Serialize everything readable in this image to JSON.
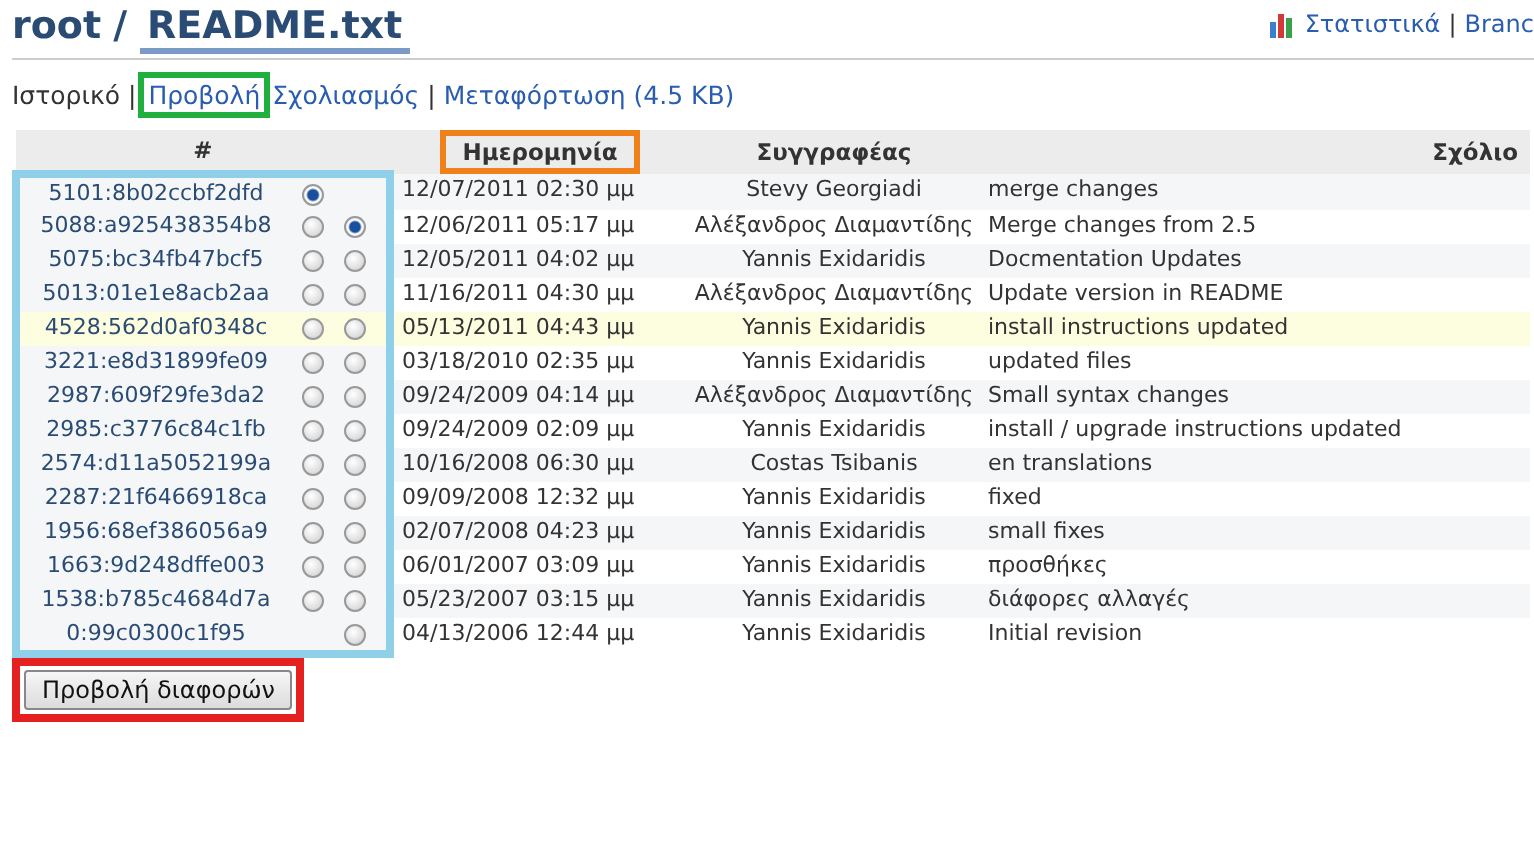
{
  "breadcrumb": {
    "root": "root",
    "separator": "/",
    "file": "README.txt"
  },
  "top_links": [
    "Στατιστικά",
    "|",
    "Branc"
  ],
  "nav": [
    {
      "label": "Ιστορικό",
      "selected": true,
      "sep": "|"
    },
    {
      "label": "Προβολή",
      "selected": false
    },
    {
      "label": "Σχολιασμός",
      "selected": false,
      "sep": "|"
    },
    {
      "label": "Μεταφόρτωση (4.5 KB)",
      "selected": false
    }
  ],
  "table": {
    "columns": [
      "#",
      "Ημερομηνία",
      "Συγγραφέας",
      "Σχόλιο"
    ],
    "rows": [
      {
        "revision": "5101:8b02ccbf2dfd",
        "old": {
          "selected": true
        },
        "new": null,
        "date": "12/07/2011 02:30 μμ",
        "author": "Stevy Georgiadi",
        "comment": "merge changes",
        "highlighted": false
      },
      {
        "revision": "5088:a925438354b8",
        "old": {
          "selected": false
        },
        "new": {
          "selected": true
        },
        "date": "12/06/2011 05:17 μμ",
        "author": "Αλέξανδρος Διαμαντίδης",
        "comment": "Merge changes from 2.5",
        "highlighted": false
      },
      {
        "revision": "5075:bc34fb47bcf5",
        "old": {
          "selected": false
        },
        "new": {
          "selected": false
        },
        "date": "12/05/2011 04:02 μμ",
        "author": "Yannis Exidaridis",
        "comment": "Docmentation Updates",
        "highlighted": false
      },
      {
        "revision": "5013:01e1e8acb2aa",
        "old": {
          "selected": false
        },
        "new": {
          "selected": false
        },
        "date": "11/16/2011 04:30 μμ",
        "author": "Αλέξανδρος Διαμαντίδης",
        "comment": "Update version in README",
        "highlighted": false
      },
      {
        "revision": "4528:562d0af0348c",
        "old": {
          "selected": false
        },
        "new": {
          "selected": false
        },
        "date": "05/13/2011 04:43 μμ",
        "author": "Yannis Exidaridis",
        "comment": "install instructions updated",
        "highlighted": true
      },
      {
        "revision": "3221:e8d31899fe09",
        "old": {
          "selected": false
        },
        "new": {
          "selected": false
        },
        "date": "03/18/2010 02:35 μμ",
        "author": "Yannis Exidaridis",
        "comment": "updated files",
        "highlighted": false
      },
      {
        "revision": "2987:609f29fe3da2",
        "old": {
          "selected": false
        },
        "new": {
          "selected": false
        },
        "date": "09/24/2009 04:14 μμ",
        "author": "Αλέξανδρος Διαμαντίδης",
        "comment": "Small syntax changes",
        "highlighted": false
      },
      {
        "revision": "2985:c3776c84c1fb",
        "old": {
          "selected": false
        },
        "new": {
          "selected": false
        },
        "date": "09/24/2009 02:09 μμ",
        "author": "Yannis Exidaridis",
        "comment": "install / upgrade instructions updated",
        "highlighted": false
      },
      {
        "revision": "2574:d11a5052199a",
        "old": {
          "selected": false
        },
        "new": {
          "selected": false
        },
        "date": "10/16/2008 06:30 μμ",
        "author": "Costas Tsibanis",
        "comment": "en translations",
        "highlighted": false
      },
      {
        "revision": "2287:21f6466918ca",
        "old": {
          "selected": false
        },
        "new": {
          "selected": false
        },
        "date": "09/09/2008 12:32 μμ",
        "author": "Yannis Exidaridis",
        "comment": "fixed",
        "highlighted": false
      },
      {
        "revision": "1956:68ef386056a9",
        "old": {
          "selected": false
        },
        "new": {
          "selected": false
        },
        "date": "02/07/2008 04:23 μμ",
        "author": "Yannis Exidaridis",
        "comment": "small fixes",
        "highlighted": false
      },
      {
        "revision": "1663:9d248dffe003",
        "old": {
          "selected": false
        },
        "new": {
          "selected": false
        },
        "date": "06/01/2007 03:09 μμ",
        "author": "Yannis Exidaridis",
        "comment": "προσθήκες",
        "highlighted": false
      },
      {
        "revision": "1538:b785c4684d7a",
        "old": {
          "selected": false
        },
        "new": {
          "selected": false
        },
        "date": "05/23/2007 03:15 μμ",
        "author": "Yannis Exidaridis",
        "comment": "διάφορες αλλαγές",
        "highlighted": false
      },
      {
        "revision": "0:99c0300c1f95",
        "old": null,
        "new": {
          "selected": false
        },
        "date": "04/13/2006 12:44 μμ",
        "author": "Yannis Exidaridis",
        "comment": "Initial revision",
        "highlighted": false
      }
    ]
  },
  "button": "Προβολή διαφορών"
}
